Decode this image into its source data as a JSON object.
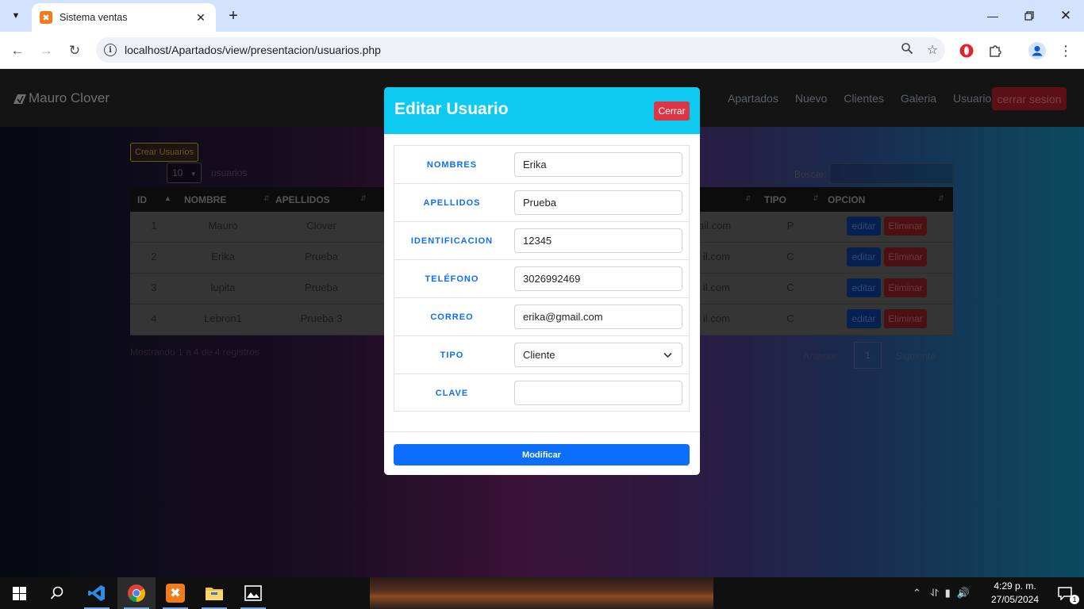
{
  "browser": {
    "tab_title": "Sistema ventas",
    "tab_favicon": "xampp-icon",
    "url": "localhost/Apartados/view/presentacion/usuarios.php"
  },
  "site": {
    "brand": "Mauro Clover",
    "nav": [
      "Apartados",
      "Nuevo",
      "Clientes",
      "Galeria",
      "Usuarios"
    ],
    "logout_label": "cerrar sesion"
  },
  "users_table": {
    "create_label": "Crear Usuarios",
    "length_value": "10",
    "length_suffix": "usuarios",
    "search_label": "Buscar:",
    "columns": {
      "id": "ID",
      "nombre": "NOMBRE",
      "apellidos": "APELLIDOS",
      "tipo": "TIPO",
      "opcion": "OPCION"
    },
    "rows": [
      {
        "id": "1",
        "nombre": "Mauro",
        "apellidos": "Clover",
        "correo": "ail.com",
        "tipo": "P"
      },
      {
        "id": "2",
        "nombre": "Erika",
        "apellidos": "Prueba",
        "correo": "il.com",
        "tipo": "C"
      },
      {
        "id": "3",
        "nombre": "lupita",
        "apellidos": "Prueba",
        "correo": "il.com",
        "tipo": "C"
      },
      {
        "id": "4",
        "nombre": "Lebron1",
        "apellidos": "Prueba 3",
        "correo": "il.com",
        "tipo": "C"
      }
    ],
    "edit_label": "editar",
    "delete_label": "Eliminar",
    "info": "Mostrando 1 a 4 de 4 registros",
    "prev_label": "Anterior",
    "current_page": "1",
    "next_label": "Siguiente"
  },
  "modal": {
    "title": "Editar Usuario",
    "close_label": "Cerrar",
    "fields": {
      "nombres": {
        "label": "NOMBRES",
        "value": "Erika"
      },
      "apellidos": {
        "label": "APELLIDOS",
        "value": "Prueba"
      },
      "identificacion": {
        "label": "IDENTIFICACION",
        "value": "12345"
      },
      "telefono": {
        "label": "TELÉFONO",
        "value": "3026992469"
      },
      "correo": {
        "label": "CORREO",
        "value": "erika@gmail.com"
      },
      "tipo": {
        "label": "TIPO",
        "value": "Cliente"
      },
      "clave": {
        "label": "CLAVE",
        "value": ""
      }
    },
    "submit_label": "Modificar"
  },
  "taskbar": {
    "time": "4:29 p. m.",
    "date": "27/05/2024",
    "notification_count": "1"
  },
  "colors": {
    "modal_header": "#0dcaf0",
    "primary": "#0d6efd",
    "danger": "#dc3545"
  }
}
